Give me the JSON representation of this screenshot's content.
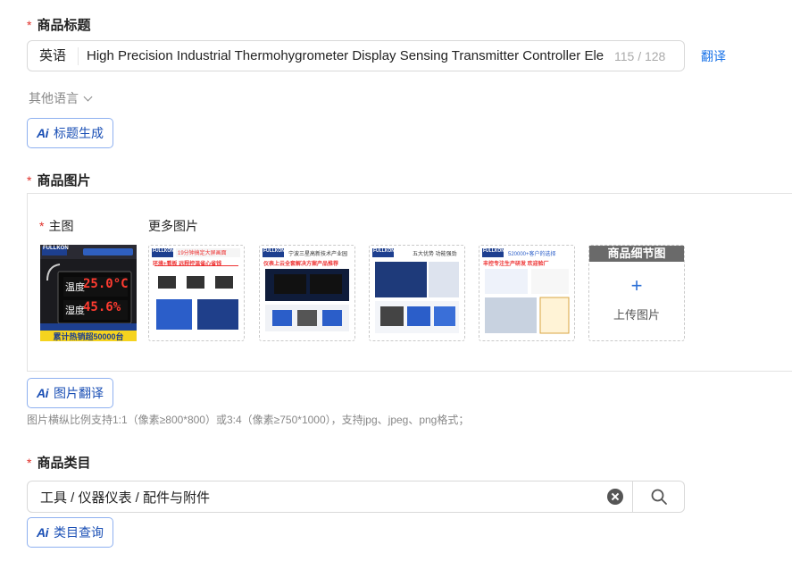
{
  "product_title": {
    "label": "商品标题",
    "required_mark": "*",
    "language": "英语",
    "value": "High Precision Industrial Thermohygrometer Display Sensing Transmitter Controller Ele",
    "counter": "115 / 128",
    "translate_link": "翻译",
    "other_languages": "其他语言",
    "ai_button": "标题生成"
  },
  "product_images": {
    "label": "商品图片",
    "required_mark": "*",
    "main_label": "主图",
    "main_required_mark": "*",
    "more_label": "更多图片",
    "thumbnails": [
      {
        "brand": "FULLKON",
        "caption": "19分钟搞定大屏画面",
        "footer": "环境+看板 远程控温省心省钱"
      },
      {
        "brand": "FULLKON",
        "caption": "宁波三星高新技术产业园",
        "footer": "仪表上云全套解决方案产品推荐"
      },
      {
        "brand": "FULLKON",
        "caption": "五大优势 功能强劲",
        "footer": ""
      },
      {
        "brand": "FULLKON",
        "caption": "520000+客户的选择",
        "footer": "丰控专注生产研发 欢迎验厂"
      }
    ],
    "main_image": {
      "brand": "FULLKON",
      "humidity_label": "湿度",
      "temp_value": "25.0°C",
      "humidity_value": "45.6%",
      "banner": "累计热销超50000台"
    },
    "upload_tile": {
      "header": "商品细节图",
      "plus": "+",
      "text": "上传图片"
    },
    "ai_button": "图片翻译",
    "hint": "图片横纵比例支持1:1（像素≥800*800）或3:4（像素≥750*1000），支持jpg、jpeg、png格式；"
  },
  "product_category": {
    "label": "商品类目",
    "required_mark": "*",
    "value": "工具 / 仪器仪表 / 配件与附件",
    "ai_button": "类目查询"
  },
  "colors": {
    "accent": "#1a73e8",
    "required": "#e0302a",
    "brand_blue": "#1d3f8f",
    "banner_yellow": "#f5d31f",
    "digit_red": "#ff3b30"
  }
}
